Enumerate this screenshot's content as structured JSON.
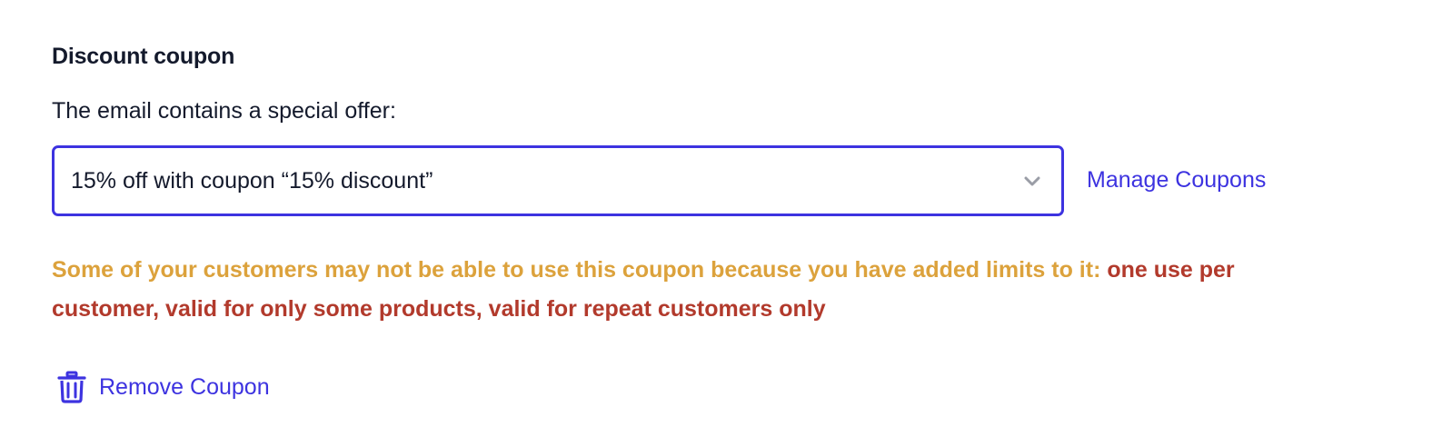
{
  "section": {
    "title": "Discount coupon",
    "offer_label": "The email contains a special offer:"
  },
  "coupon_select": {
    "selected_value": "15% off with coupon “15% discount”",
    "icon": "chevron-down-icon"
  },
  "links": {
    "manage_coupons": "Manage Coupons",
    "remove_coupon": "Remove Coupon",
    "remove_icon": "trash-icon"
  },
  "warning": {
    "message": "Some of your customers may not be able to use this coupon because you have added limits to it: ",
    "limits": "one use per customer, valid for only some products, valid for repeat customers only"
  },
  "colors": {
    "accent": "#3d33e0",
    "text": "#141a2c",
    "warning": "#dca23c",
    "limits": "#b23a2c",
    "chevron": "#9a9da6"
  }
}
